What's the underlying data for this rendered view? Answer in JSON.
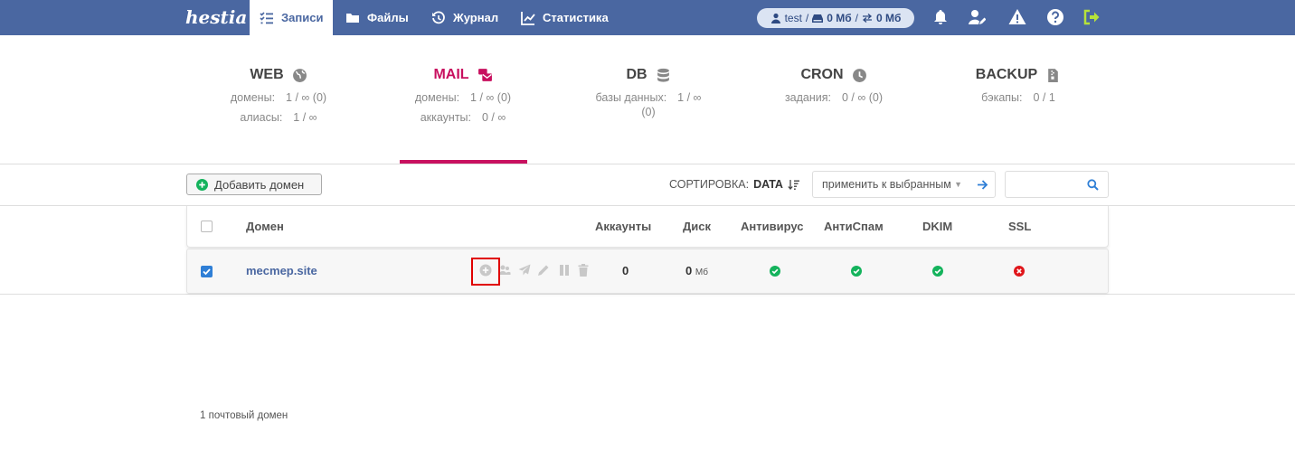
{
  "logo": {
    "text": "hestia"
  },
  "nav": {
    "tabs": [
      {
        "label": "Записи",
        "icon": "list-icon",
        "active": true
      },
      {
        "label": "Файлы",
        "icon": "folder-icon"
      },
      {
        "label": "Журнал",
        "icon": "history-icon"
      },
      {
        "label": "Статистика",
        "icon": "chart-icon"
      }
    ],
    "user": {
      "name": "test",
      "disk": "0 Мб",
      "bandwidth": "0 Мб"
    },
    "icons": [
      "bell-icon",
      "user-edit-icon",
      "warning-icon",
      "help-icon",
      "logout-icon"
    ]
  },
  "stats": {
    "web": {
      "title": "WEB",
      "rows": [
        {
          "label": "домены:",
          "value": "1 / ∞ (0)"
        },
        {
          "label": "алиасы:",
          "value": "1 / ∞"
        }
      ]
    },
    "mail": {
      "title": "MAIL",
      "rows": [
        {
          "label": "домены:",
          "value": "1 / ∞ (0)"
        },
        {
          "label": "аккаунты:",
          "value": "0 / ∞"
        }
      ]
    },
    "db": {
      "title": "DB",
      "rows": [
        {
          "label": "базы данных:",
          "value": "1 / ∞",
          "extra": "(0)"
        }
      ]
    },
    "cron": {
      "title": "CRON",
      "rows": [
        {
          "label": "задания:",
          "value": "0 / ∞ (0)"
        }
      ]
    },
    "backup": {
      "title": "BACKUP",
      "rows": [
        {
          "label": "бэкапы:",
          "value": "0 / 1"
        }
      ]
    }
  },
  "toolbar": {
    "add_label": "Добавить домен",
    "sort_label": "СОРТИРОВКА:",
    "sort_value": "DATA",
    "bulk_label": "применить к выбранным",
    "search_placeholder": ""
  },
  "table": {
    "headers": {
      "domain": "Домен",
      "accounts": "Аккаунты",
      "disk": "Диск",
      "antivirus": "Антивирус",
      "antispam": "АнтиСпам",
      "dkim": "DKIM",
      "ssl": "SSL"
    },
    "rows": [
      {
        "domain": "mecmep.site",
        "checked": true,
        "accounts": "0",
        "disk": "0",
        "disk_unit": "Мб",
        "antivirus": "ok",
        "antispam": "ok",
        "dkim": "ok",
        "ssl": "error"
      }
    ]
  },
  "footer": {
    "text": "1 почтовый домен"
  },
  "colors": {
    "topbar": "#4a67a1",
    "accent": "#c8105f",
    "ok": "#14b35c",
    "error": "#e0161b",
    "highlight": "#e00000"
  }
}
